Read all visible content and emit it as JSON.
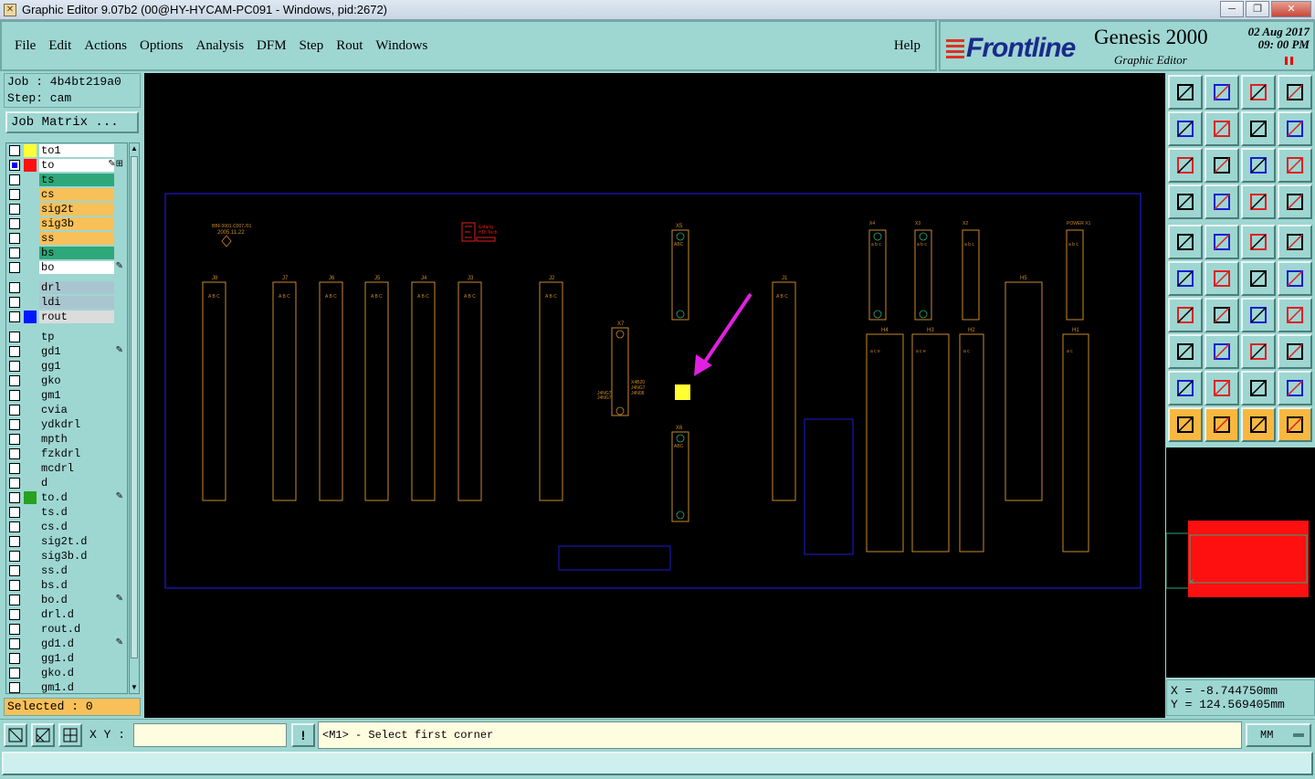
{
  "window": {
    "title": "Graphic Editor 9.07b2 (00@HY-HYCAM-PC091 - Windows, pid:2672)",
    "controls": [
      "minimize-icon",
      "maximize-icon",
      "close-icon"
    ]
  },
  "menu": {
    "items": [
      "File",
      "Edit",
      "Actions",
      "Options",
      "Analysis",
      "DFM",
      "Step",
      "Rout",
      "Windows"
    ],
    "help": "Help"
  },
  "brand": {
    "logo": "Frontline",
    "product": "Genesis 2000",
    "subtitle": "Graphic Editor",
    "date": "02  Aug 2017",
    "time": "09: 00  PM"
  },
  "job": {
    "job_label": "Job : 4b4bt219a0",
    "step_label": "Step: cam",
    "matrix_button": "Job Matrix ..."
  },
  "layers": [
    {
      "name": "to1",
      "swatch": "#ffff33",
      "fill": "#ffffff",
      "mark": ""
    },
    {
      "name": "to",
      "swatch": "#ff1010",
      "fill": "#ffffff",
      "mark": "✎⊞",
      "checked": "#0000ff"
    },
    {
      "name": "ts",
      "swatch": "",
      "fill": "#2ea87a",
      "mark": ""
    },
    {
      "name": "cs",
      "swatch": "",
      "fill": "#f8c058",
      "mark": ""
    },
    {
      "name": "sig2t",
      "swatch": "",
      "fill": "#f8c058",
      "mark": ""
    },
    {
      "name": "sig3b",
      "swatch": "",
      "fill": "#f8c058",
      "mark": ""
    },
    {
      "name": "ss",
      "swatch": "",
      "fill": "#f8c058",
      "mark": ""
    },
    {
      "name": "bs",
      "swatch": "",
      "fill": "#2ea87a",
      "mark": ""
    },
    {
      "name": "bo",
      "swatch": "",
      "fill": "#ffffff",
      "mark": "✎",
      "sep": true
    },
    {
      "name": "drl",
      "swatch": "",
      "fill": "#a9c6d0",
      "mark": ""
    },
    {
      "name": "ldi",
      "swatch": "",
      "fill": "#a9c6d0",
      "mark": ""
    },
    {
      "name": "rout",
      "swatch": "#0018ff",
      "fill": "#dcdcdc",
      "mark": "",
      "sep": true
    },
    {
      "name": "tp",
      "swatch": "",
      "fill": "#9ed6d2",
      "mark": ""
    },
    {
      "name": "gd1",
      "swatch": "",
      "fill": "#9ed6d2",
      "mark": "✎"
    },
    {
      "name": "gg1",
      "swatch": "",
      "fill": "#9ed6d2",
      "mark": ""
    },
    {
      "name": "gko",
      "swatch": "",
      "fill": "#9ed6d2",
      "mark": ""
    },
    {
      "name": "gm1",
      "swatch": "",
      "fill": "#9ed6d2",
      "mark": ""
    },
    {
      "name": "cvia",
      "swatch": "",
      "fill": "#9ed6d2",
      "mark": ""
    },
    {
      "name": "ydkdrl",
      "swatch": "",
      "fill": "#9ed6d2",
      "mark": ""
    },
    {
      "name": "mpth",
      "swatch": "",
      "fill": "#9ed6d2",
      "mark": ""
    },
    {
      "name": "fzkdrl",
      "swatch": "",
      "fill": "#9ed6d2",
      "mark": ""
    },
    {
      "name": "mcdrl",
      "swatch": "",
      "fill": "#9ed6d2",
      "mark": ""
    },
    {
      "name": "d",
      "swatch": "",
      "fill": "#9ed6d2",
      "mark": ""
    },
    {
      "name": "to.d",
      "swatch": "#28a020",
      "fill": "#9ed6d2",
      "mark": "✎"
    },
    {
      "name": "ts.d",
      "swatch": "",
      "fill": "#9ed6d2",
      "mark": ""
    },
    {
      "name": "cs.d",
      "swatch": "",
      "fill": "#9ed6d2",
      "mark": ""
    },
    {
      "name": "sig2t.d",
      "swatch": "",
      "fill": "#9ed6d2",
      "mark": ""
    },
    {
      "name": "sig3b.d",
      "swatch": "",
      "fill": "#9ed6d2",
      "mark": ""
    },
    {
      "name": "ss.d",
      "swatch": "",
      "fill": "#9ed6d2",
      "mark": ""
    },
    {
      "name": "bs.d",
      "swatch": "",
      "fill": "#9ed6d2",
      "mark": ""
    },
    {
      "name": "bo.d",
      "swatch": "",
      "fill": "#9ed6d2",
      "mark": "✎"
    },
    {
      "name": "drl.d",
      "swatch": "",
      "fill": "#9ed6d2",
      "mark": ""
    },
    {
      "name": "rout.d",
      "swatch": "",
      "fill": "#9ed6d2",
      "mark": ""
    },
    {
      "name": "gd1.d",
      "swatch": "",
      "fill": "#9ed6d2",
      "mark": "✎"
    },
    {
      "name": "gg1.d",
      "swatch": "",
      "fill": "#9ed6d2",
      "mark": ""
    },
    {
      "name": "gko.d",
      "swatch": "",
      "fill": "#9ed6d2",
      "mark": ""
    },
    {
      "name": "gm1.d",
      "swatch": "",
      "fill": "#9ed6d2",
      "mark": ""
    }
  ],
  "selected": "Selected : 0",
  "board": {
    "connectors": [
      "J8",
      "J7",
      "J6",
      "J5",
      "J4",
      "J3",
      "J2",
      "J1"
    ],
    "headers_top": [
      "X5",
      "X4",
      "X3",
      "X2",
      "POWER X1"
    ],
    "headers_bottom": [
      "H5",
      "H4",
      "H3",
      "H2",
      "H1"
    ],
    "misc": [
      "X7",
      "X6",
      "ABC",
      "ABC",
      "2005.11.22"
    ]
  },
  "coords": {
    "x": "X = -8.744750mm",
    "y": "Y = 124.569405mm"
  },
  "status": {
    "xy_label": "X Y :",
    "xy_value": "",
    "warn": "!",
    "message": "<M1> - Select first corner",
    "units": "MM"
  },
  "colors": {
    "panel": "#9ed6d2",
    "outline": "#1b1bd0",
    "component": "#c88a2a",
    "highlight": "#ffff33",
    "arrow": "#e020e0"
  }
}
